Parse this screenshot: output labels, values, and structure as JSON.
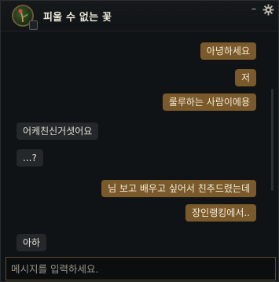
{
  "header": {
    "title": "피울 수 없는 꽃",
    "minimize_glyph": "–"
  },
  "messages": [
    {
      "side": "out",
      "text": "아녕하세요"
    },
    {
      "side": "out",
      "text": "저"
    },
    {
      "side": "out",
      "text": "룰루하는 사람이에용"
    },
    {
      "side": "in",
      "text": "어케친신거셧어요"
    },
    {
      "side": "in",
      "text": "...?"
    },
    {
      "side": "out",
      "text": "님 보고 배우고 싶어서 친추드렸는데"
    },
    {
      "side": "out",
      "text": "장인랭킹에서.."
    },
    {
      "side": "in",
      "text": "아하"
    }
  ],
  "composer": {
    "placeholder": "메시지를 입력하세요."
  },
  "colors": {
    "outgoing_bubble": "#7a5a2b",
    "incoming_bubble": "#24282b",
    "input_border": "#5e4c2a"
  }
}
